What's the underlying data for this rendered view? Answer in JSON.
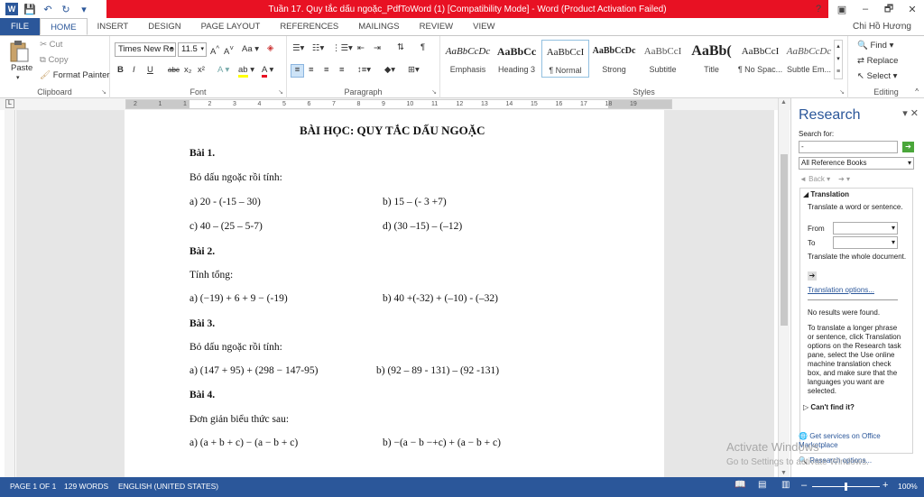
{
  "window": {
    "title": "Tuần 17. Quy tắc dấu ngoặc_PdfToWord (1) [Compatibility Mode] - Word (Product Activation Failed)",
    "controls": [
      "?",
      "▣",
      "–",
      "🗗",
      "✕"
    ]
  },
  "tabs": [
    "FILE",
    "HOME",
    "INSERT",
    "DESIGN",
    "PAGE LAYOUT",
    "REFERENCES",
    "MAILINGS",
    "REVIEW",
    "VIEW"
  ],
  "active_tab": "HOME",
  "user": "Chi Hồ Hương",
  "ribbon": {
    "clipboard": {
      "paste": "Paste",
      "cut": "Cut",
      "copy": "Copy",
      "format_painter": "Format Painter",
      "label": "Clipboard"
    },
    "font": {
      "family": "Times New Ro",
      "size": "11.5",
      "label": "Font",
      "buttons": [
        "B",
        "I",
        "U",
        "abc",
        "x₂",
        "x²"
      ]
    },
    "paragraph": {
      "label": "Paragraph"
    },
    "styles": {
      "label": "Styles",
      "items": [
        {
          "preview": "AaBbCcDc",
          "name": "Emphasis"
        },
        {
          "preview": "AaBbCc",
          "name": "Heading 3"
        },
        {
          "preview": "AaBbCcI",
          "name": "¶ Normal"
        },
        {
          "preview": "AaBbCcDc",
          "name": "Strong"
        },
        {
          "preview": "AaBbCcI",
          "name": "Subtitle"
        },
        {
          "preview": "AaBb(",
          "name": "Title"
        },
        {
          "preview": "AaBbCcI",
          "name": "¶ No Spac..."
        },
        {
          "preview": "AaBbCcDc",
          "name": "Subtle Em..."
        }
      ]
    },
    "editing": {
      "find": "Find",
      "replace": "Replace",
      "select": "Select",
      "label": "Editing"
    }
  },
  "ruler_numbers": [
    "2",
    "1",
    "1",
    "2",
    "3",
    "4",
    "5",
    "6",
    "7",
    "8",
    "9",
    "10",
    "11",
    "12",
    "13",
    "14",
    "15",
    "16",
    "17",
    "18",
    "19"
  ],
  "document": {
    "title": "BÀI HỌC: QUY TẮC DẤU NGOẶC",
    "b1": "Bài 1.",
    "b1_desc": "Bỏ dấu ngoặc rồi tính:",
    "b1_a": "a) 20 - (-15 – 30)",
    "b1_b": "b) 15 – (- 3 +7)",
    "b1_c": "c) 40 – (25 – 5-7)",
    "b1_d": "d) (30 –15) – (–12)",
    "b2": "Bài 2.",
    "b2_desc": "Tính tổng:",
    "b2_a": "a) (−19) + 6 + 9 − (-19)",
    "b2_b": "b) 40 +(-32) + (–10) - (–32)",
    "b3": "Bài 3.",
    "b3_desc": "Bỏ dấu ngoặc rồi tính:",
    "b3_a": "a)  (147 + 95) + (298 − 147-95)",
    "b3_b": "b) (92 – 89 - 131) – (92 -131)",
    "b4": "Bài 4.",
    "b4_desc": "Đơn giản biểu thức sau:",
    "b4_a": "a)  (a + b + c) − (a − b + c)",
    "b4_b": "b) −(a − b −+c) + (a − b + c)"
  },
  "research": {
    "title": "Research",
    "search_label": "Search for:",
    "search_value": "-",
    "source": "All Reference Books",
    "back": "Back",
    "translation_header": "Translation",
    "translate_word": "Translate a word or sentence.",
    "from": "From",
    "to": "To",
    "translate_doc": "Translate the whole document.",
    "translation_options": "Translation options...",
    "no_results": "No results were found.",
    "help": "To translate a longer phrase or sentence, click Translation options on the Research task pane, select the Use online machine translation check box, and make sure that the languages you want are selected.",
    "cant_find": "Can't find it?",
    "get_services": "Get services on Office Marketplace",
    "research_options": "Research options..."
  },
  "watermark": {
    "line1": "Activate Windows",
    "line2": "Go to Settings to activate Windows."
  },
  "status": {
    "page": "PAGE 1 OF 1",
    "words": "129 WORDS",
    "language": "ENGLISH (UNITED STATES)",
    "zoom": "100%"
  }
}
